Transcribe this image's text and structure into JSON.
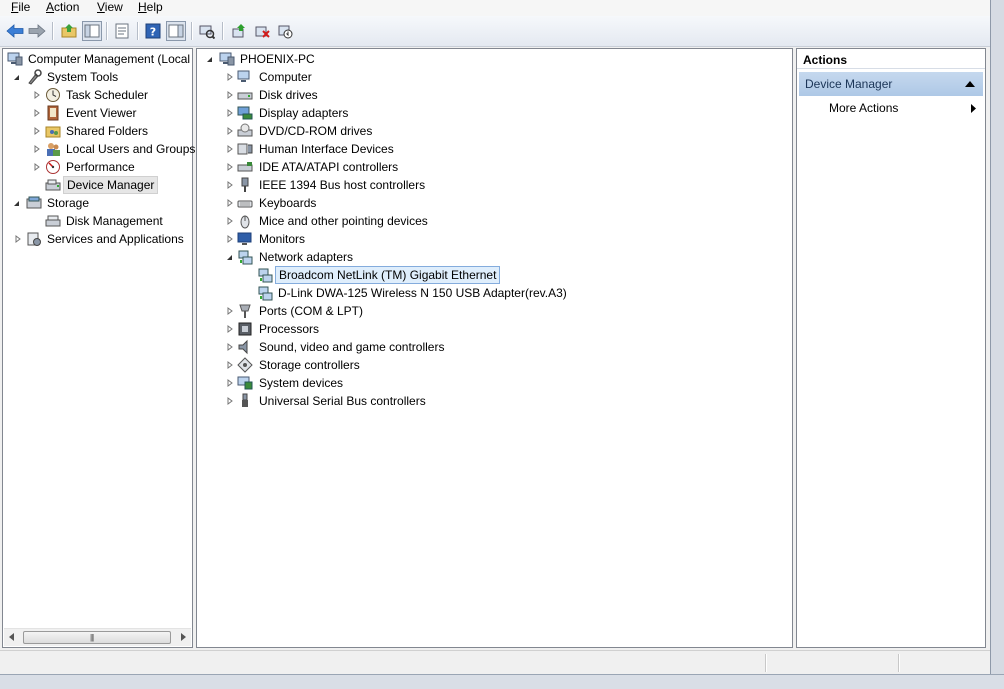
{
  "menu": [
    {
      "label": "File",
      "accel": "F",
      "rest": "ile"
    },
    {
      "label": "Action",
      "accel": "A",
      "rest": "ction"
    },
    {
      "label": "View",
      "accel": "V",
      "rest": "iew"
    },
    {
      "label": "Help",
      "accel": "H",
      "rest": "elp"
    }
  ],
  "toolbar": {
    "icons": [
      "back-arrow-icon",
      "forward-arrow-icon",
      "up-folder-icon",
      "show-hide-console-tree-icon",
      "properties-icon",
      "help-icon",
      "show-hide-action-pane-icon",
      "scan-hardware-changes-icon",
      "update-driver-icon",
      "uninstall-icon",
      "disable-device-icon"
    ]
  },
  "left_tree": {
    "root": "Computer Management (Local",
    "items": [
      {
        "label": "System Tools"
      },
      {
        "label": "Task Scheduler"
      },
      {
        "label": "Event Viewer"
      },
      {
        "label": "Shared Folders"
      },
      {
        "label": "Local Users and Groups"
      },
      {
        "label": "Performance"
      },
      {
        "label": "Device Manager"
      },
      {
        "label": "Storage"
      },
      {
        "label": "Disk Management"
      },
      {
        "label": "Services and Applications"
      }
    ]
  },
  "device_tree": {
    "root": "PHOENIX-PC",
    "categories": [
      {
        "label": "Computer"
      },
      {
        "label": "Disk drives"
      },
      {
        "label": "Display adapters"
      },
      {
        "label": "DVD/CD-ROM drives"
      },
      {
        "label": "Human Interface Devices"
      },
      {
        "label": "IDE ATA/ATAPI controllers"
      },
      {
        "label": "IEEE 1394 Bus host controllers"
      },
      {
        "label": "Keyboards"
      },
      {
        "label": "Mice and other pointing devices"
      },
      {
        "label": "Monitors"
      },
      {
        "label": "Network adapters"
      },
      {
        "label": "Ports (COM & LPT)"
      },
      {
        "label": "Processors"
      },
      {
        "label": "Sound, video and game controllers"
      },
      {
        "label": "Storage controllers"
      },
      {
        "label": "System devices"
      },
      {
        "label": "Universal Serial Bus controllers"
      }
    ],
    "network_children": [
      {
        "label": "Broadcom NetLink (TM) Gigabit Ethernet"
      },
      {
        "label": "D-Link DWA-125 Wireless N 150 USB Adapter(rev.A3)"
      }
    ]
  },
  "actions": {
    "header": "Actions",
    "section": "Device Manager",
    "more": "More Actions"
  },
  "colors": {
    "selection_blue": "#dfeefc",
    "selection_border": "#84acdd",
    "actions_section": "#b9cfea"
  }
}
